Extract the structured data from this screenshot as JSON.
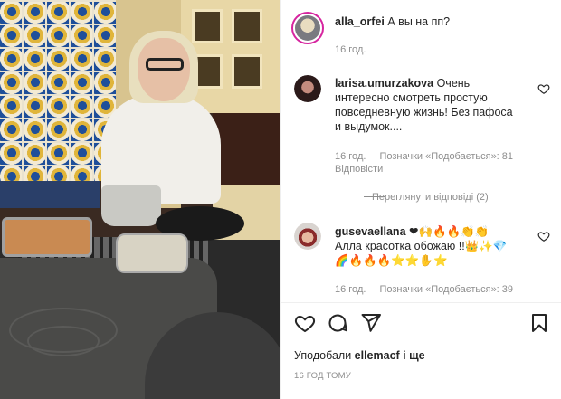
{
  "post": {
    "author": "alla_orfei",
    "caption": "А вы на пп?",
    "time": "16 год."
  },
  "comments": [
    {
      "user": "larisa.umurzakova",
      "text_lines": [
        "Очень",
        "интересно смотреть простую",
        "повседневную жизнь! Без пафоса",
        "и выдумок...."
      ],
      "time": "16 год.",
      "likes": "Позначки «Подобається»: 81",
      "reply": "Відповісти",
      "view_replies": "Переглянути відповіді (2)"
    },
    {
      "user": "gusevaellana",
      "emoji_line1": "❤🙌🔥🔥👏👏",
      "text_line2": "Алла красотка обожаю !!👑✨💎",
      "emoji_line3": "🌈🔥🔥🔥⭐⭐✋⭐",
      "time": "16 год.",
      "likes": "Позначки «Подобається»: 39"
    }
  ],
  "actions": {
    "icons": [
      "heart-icon",
      "comment-icon",
      "share-icon",
      "bookmark-icon"
    ]
  },
  "likes_line": {
    "prefix": "Уподобали",
    "user": "ellemacf",
    "suffix": "і ще"
  },
  "timestamp": "16 ГОД ТОМУ",
  "colors": {
    "story_ring": "#d6249f",
    "text": "#262626",
    "muted": "#8e8e8e"
  }
}
